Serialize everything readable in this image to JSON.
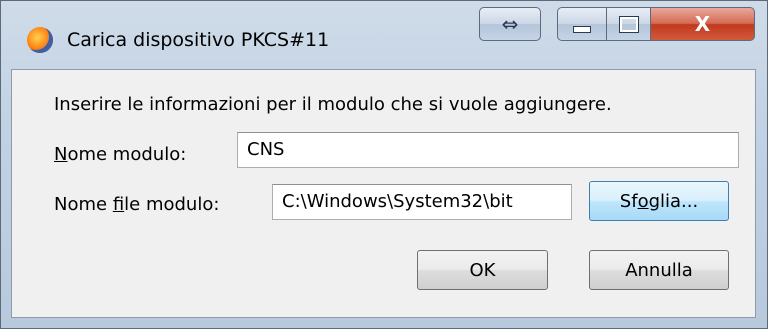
{
  "window": {
    "title": "Carica dispositivo PKCS#11"
  },
  "titlebar_buttons": {
    "resize_glyph": "⇔",
    "close_glyph": "X"
  },
  "dialog": {
    "prompt": "Inserire le informazioni per il modulo che si vuole aggiungere.",
    "module_name_label_access": "N",
    "module_name_label_rest": "ome modulo:",
    "module_name_value": "CNS",
    "module_file_label_pre": "Nome ",
    "module_file_label_access": "f",
    "module_file_label_rest": "ile modulo:",
    "module_file_value": "C:\\Windows\\System32\\bit",
    "browse_pre": "Sf",
    "browse_access": "o",
    "browse_rest": "glia...",
    "ok_label": "OK",
    "cancel_label": "Annulla"
  },
  "colors": {
    "client_bg": "#f0f0f0",
    "close_button": "#c1391c",
    "focused_button_border": "#3c7fb1"
  }
}
